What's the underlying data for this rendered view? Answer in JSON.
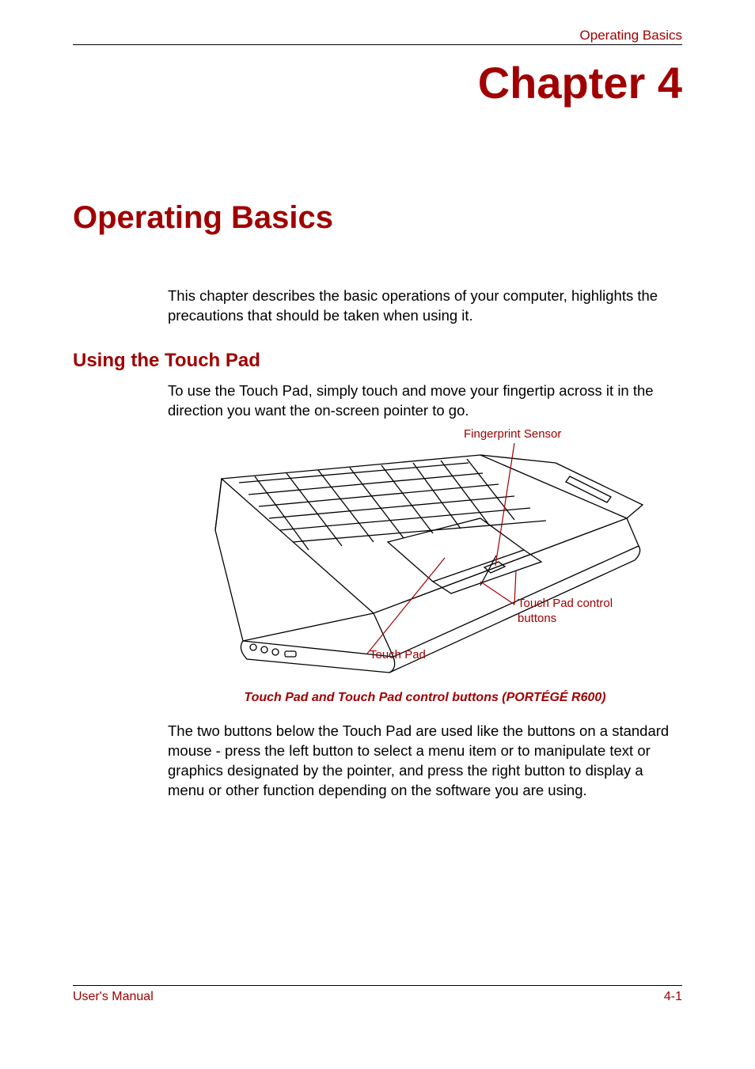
{
  "header": {
    "running_title": "Operating Basics"
  },
  "chapter": {
    "title": "Chapter 4"
  },
  "section": {
    "title": "Operating Basics",
    "intro": "This chapter describes the basic operations of your computer, highlights the precautions that should be taken when using it."
  },
  "subsection": {
    "title": "Using the Touch Pad",
    "intro": "To use the Touch Pad, simply touch and move your fingertip across it in the direction you want the on-screen pointer to go."
  },
  "diagram": {
    "labels": {
      "fingerprint": "Fingerprint Sensor",
      "touchpad_control": "Touch Pad control buttons",
      "touchpad": "Touch Pad"
    },
    "caption": "Touch Pad and Touch Pad control buttons (PORTÉGÉ R600)"
  },
  "body": {
    "para2": "The two buttons below the Touch Pad are used like the buttons on a standard mouse - press the left button to select a menu item or to manipulate text or graphics designated by the pointer, and press the right button to display a menu or other function depending on the software you are using."
  },
  "footer": {
    "left": "User's Manual",
    "right": "4-1"
  }
}
